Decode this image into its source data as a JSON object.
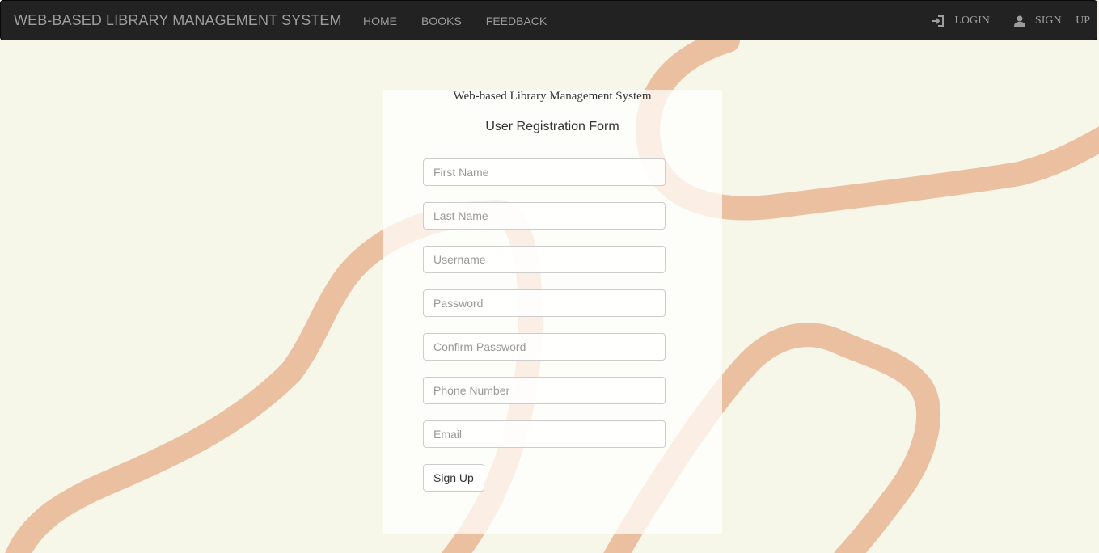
{
  "navbar": {
    "brand": "WEB-BASED LIBRARY MANAGEMENT SYSTEM",
    "links": [
      "HOME",
      "BOOKS",
      "FEEDBACK"
    ],
    "right": {
      "login_label": "LOGIN",
      "login_icon": "log-in-icon",
      "signup_label": "SIGN UP",
      "signup_icon": "user-icon"
    }
  },
  "panel": {
    "site_title": "Web-based Library Management System",
    "form_title": "User Registration Form",
    "fields": {
      "first_name": "First Name",
      "last_name": "Last Name",
      "username": "Username",
      "password": "Password",
      "confirm_password": "Confirm Password",
      "phone": "Phone Number",
      "email": "Email"
    },
    "submit_label": "Sign Up"
  },
  "colors": {
    "background": "#f6f6e9",
    "navbar": "#222222",
    "nav_text": "#9d9d9d",
    "decor_stroke": "#ebc0a1"
  }
}
